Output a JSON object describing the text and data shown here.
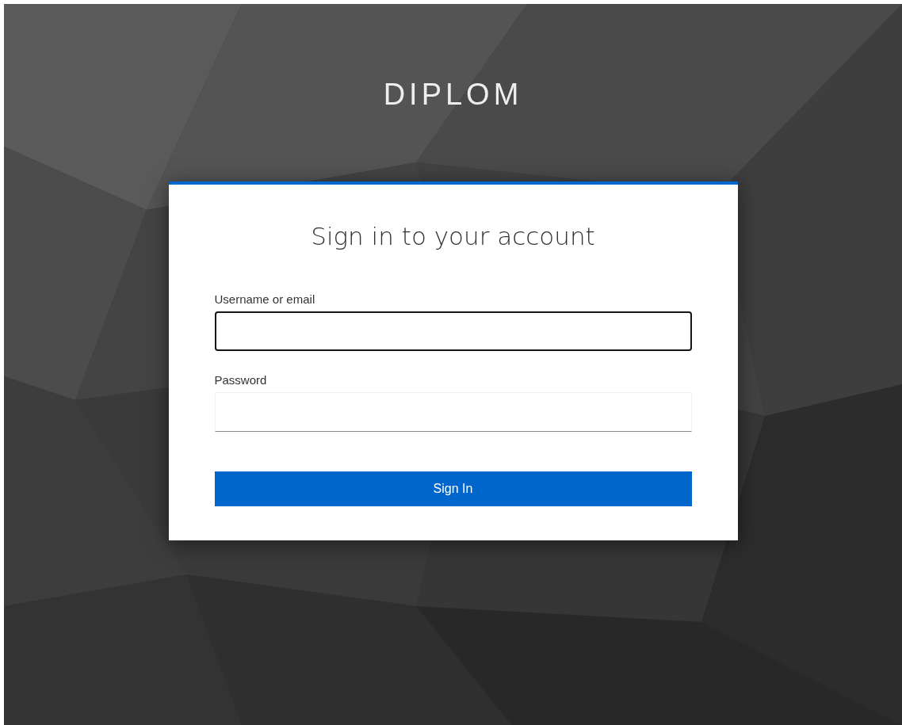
{
  "brand": "DIPLOM",
  "card": {
    "title": "Sign in to your account",
    "fields": [
      {
        "label": "Username or email",
        "focused": true
      },
      {
        "label": "Password",
        "focused": false
      }
    ],
    "button": "Sign In"
  }
}
